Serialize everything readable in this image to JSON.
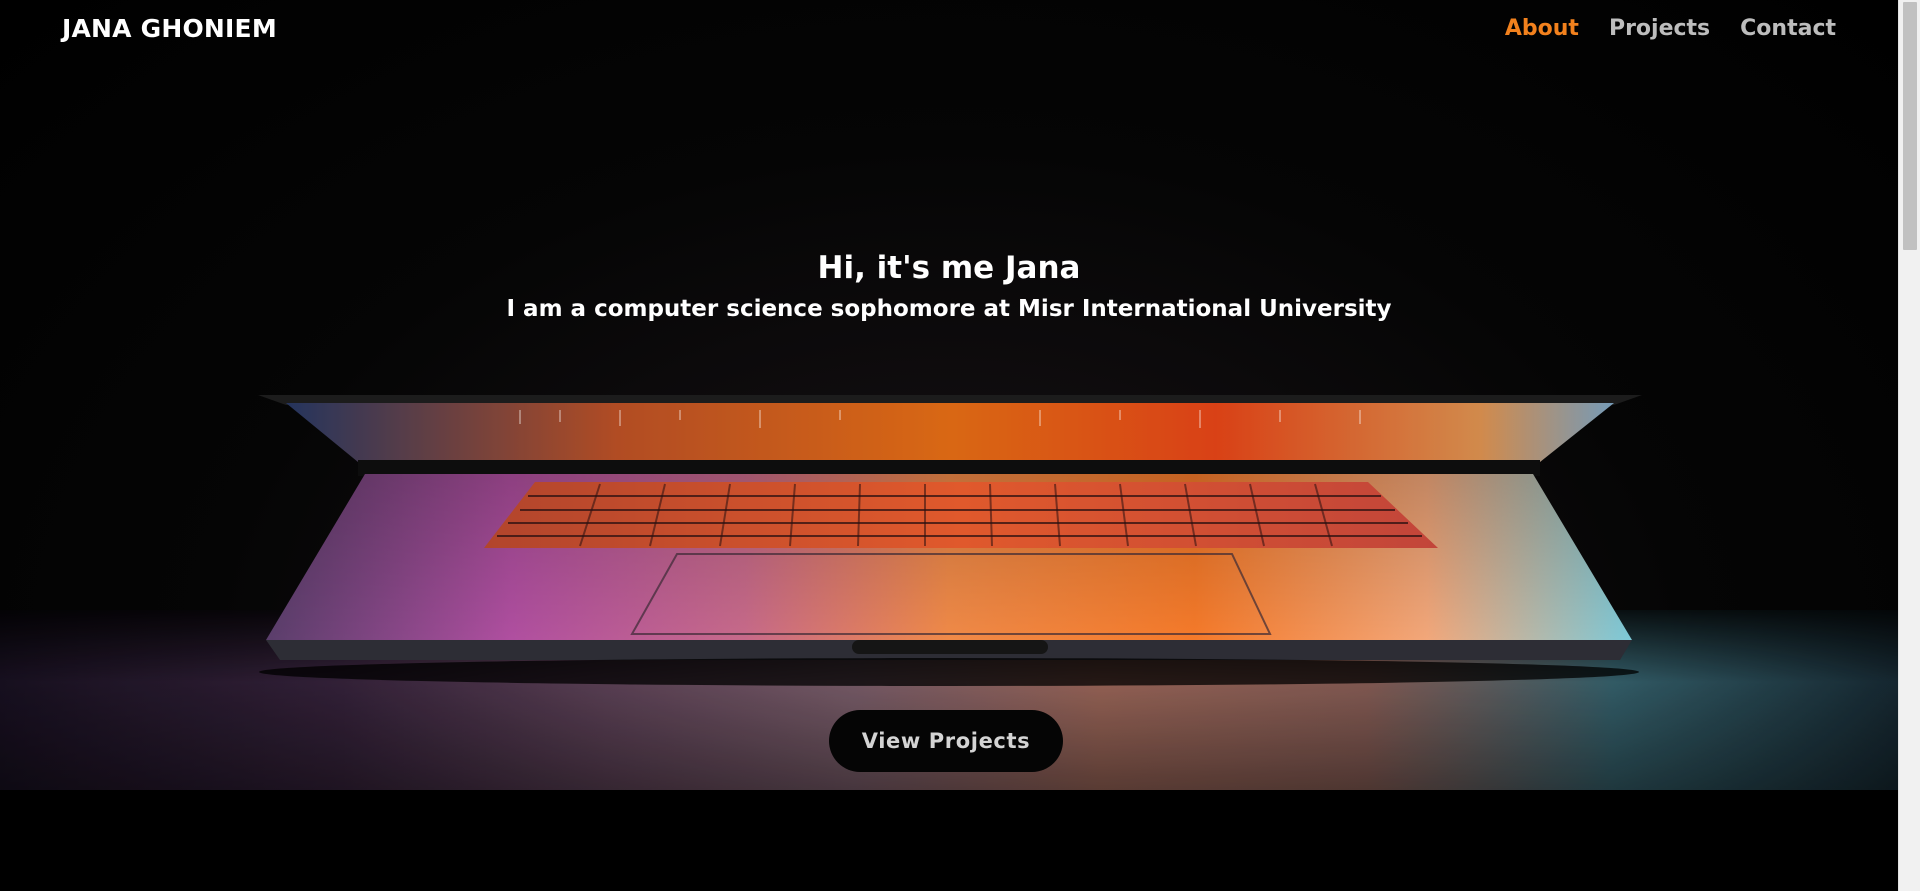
{
  "nav": {
    "brand": "JANA GHONIEM",
    "links": [
      {
        "label": "About",
        "active": true
      },
      {
        "label": "Projects",
        "active": false
      },
      {
        "label": "Contact",
        "active": false
      }
    ]
  },
  "hero": {
    "greeting": "Hi, it's me Jana",
    "tagline": "I am a computer science sophomore at Misr International University",
    "cta_label": "View Projects",
    "background_image": "laptop-glow-image"
  },
  "colors": {
    "accent": "#f2811d",
    "nav_link": "#bdbdbd",
    "background": "#000000"
  }
}
